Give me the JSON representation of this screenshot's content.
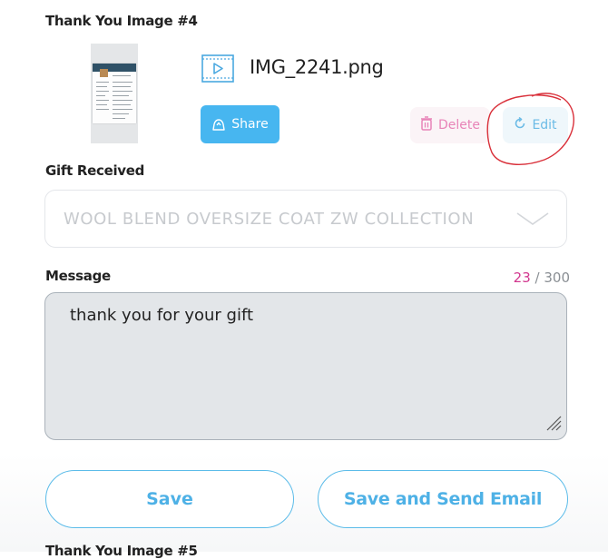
{
  "card": {
    "title": "Thank You Image #4",
    "file_name": "IMG_2241.png",
    "share_label": "Share",
    "delete_label": "Delete",
    "edit_label": "Edit",
    "thumbnail_icon": "resume-document-thumbnail",
    "file_icon": "video-file-icon"
  },
  "gift": {
    "label": "Gift Received",
    "selected_value": "WOOL BLEND OVERSIZE COAT ZW COLLECTION"
  },
  "message": {
    "label": "Message",
    "count": "23",
    "separator": " / ",
    "max": "300",
    "text": "thank you for your gift"
  },
  "actions": {
    "save_label": "Save",
    "save_send_label": "Save and Send Email"
  },
  "next_card": {
    "title": "Thank You Image #5"
  },
  "colors": {
    "accent_blue": "#47b6f0",
    "delete_pink": "#e884b8",
    "counter_magenta": "#d2388f",
    "annotation_red": "#d9303a"
  }
}
